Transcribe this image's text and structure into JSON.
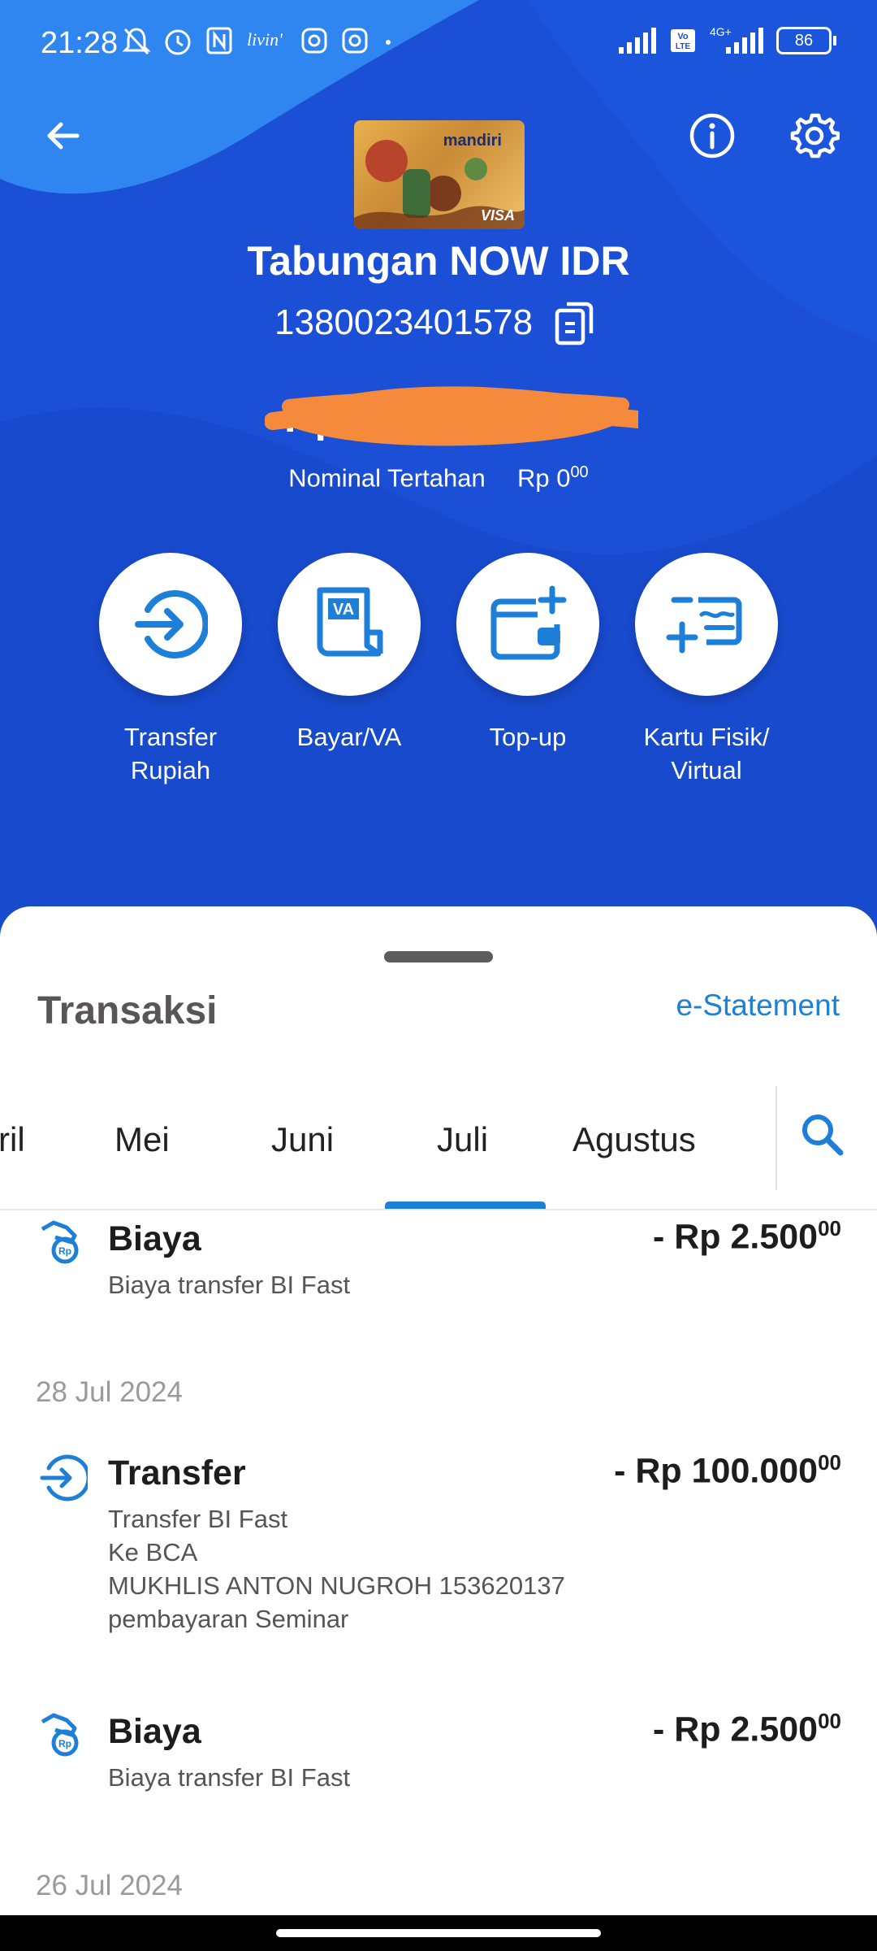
{
  "status_bar": {
    "time": "21:28",
    "battery": "86",
    "network": "4G+",
    "volte": "Vo LTE",
    "icons_left": [
      "mute-bell-icon",
      "alarm-icon",
      "nfc-icon",
      "livin-icon",
      "instagram-icon",
      "instagram-icon",
      "dot-icon"
    ]
  },
  "header": {
    "back_icon": "arrow-left-icon",
    "info_icon": "info-icon",
    "settings_icon": "gear-icon",
    "card_brand": "mandiri",
    "card_network": "VISA",
    "account_name": "Tabungan NOW IDR",
    "account_number": "1380023401578",
    "copy_icon": "copy-icon",
    "balance_hidden": "Rp",
    "hold_label": "Nominal Tertahan",
    "hold_amount": "Rp 0",
    "hold_cents": "00"
  },
  "actions": [
    {
      "label_line1": "Transfer",
      "label_line2": "Rupiah",
      "icon": "transfer-icon"
    },
    {
      "label_line1": "Bayar/VA",
      "label_line2": "",
      "icon": "va-icon"
    },
    {
      "label_line1": "Top-up",
      "label_line2": "",
      "icon": "wallet-plus-icon"
    },
    {
      "label_line1": "Kartu Fisik/",
      "label_line2": "Virtual",
      "icon": "card-plus-icon"
    }
  ],
  "transactions_section": {
    "title": "Transaksi",
    "estatement": "e-Statement",
    "tabs": [
      "ril",
      "Mei",
      "Juni",
      "Juli",
      "Agustus"
    ],
    "active_tab": "Juli"
  },
  "transactions": [
    {
      "type": "Biaya",
      "desc": [
        "Biaya transfer BI Fast"
      ],
      "amount": "- Rp 2.500",
      "cents": "00",
      "icon": "fee-icon"
    },
    {
      "date": "28 Jul 2024"
    },
    {
      "type": "Transfer",
      "desc": [
        "Transfer BI Fast",
        "Ke BCA",
        "MUKHLIS ANTON NUGROH 153620137",
        "pembayaran Seminar"
      ],
      "amount": "- Rp 100.000",
      "cents": "00",
      "icon": "transfer-icon"
    },
    {
      "type": "Biaya",
      "desc": [
        "Biaya transfer BI Fast"
      ],
      "amount": "- Rp 2.500",
      "cents": "00",
      "icon": "fee-icon"
    },
    {
      "date": "26 Jul 2024"
    }
  ],
  "colors": {
    "hero_blue": "#1a4fd6",
    "accent_blue": "#1d7fd8",
    "redaction_orange": "#f58a3c"
  }
}
